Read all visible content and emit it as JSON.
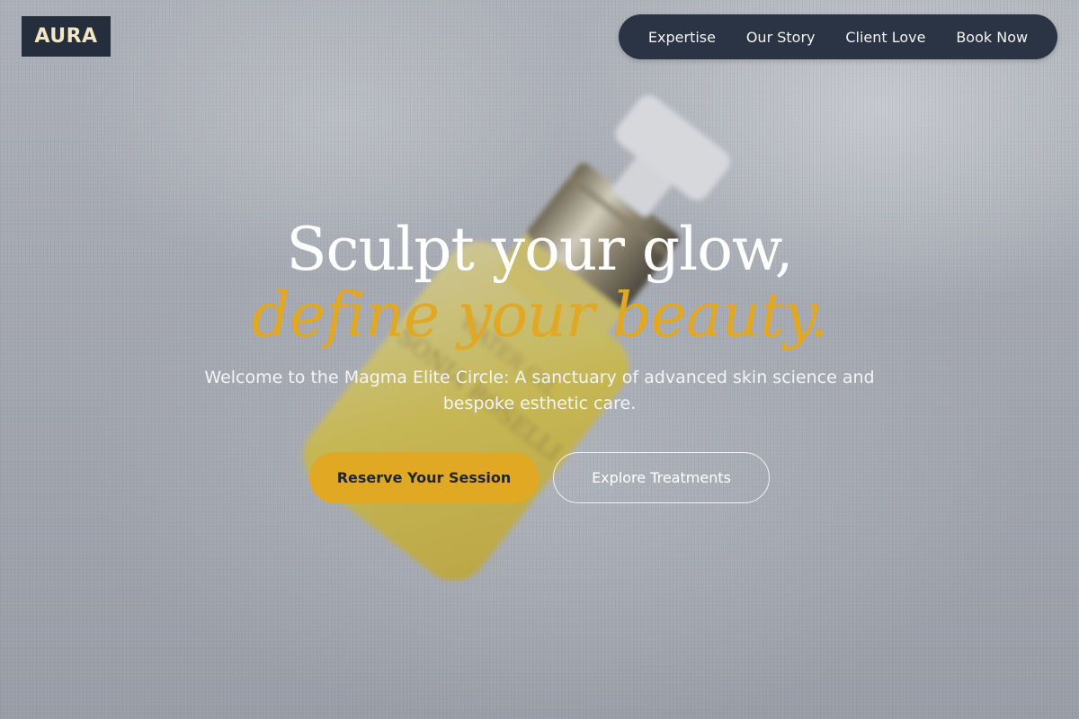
{
  "brand": {
    "logo_text": "AURA"
  },
  "nav": {
    "items": [
      {
        "label": "Expertise"
      },
      {
        "label": "Our Story"
      },
      {
        "label": "Client Love"
      },
      {
        "label": "Book Now"
      }
    ]
  },
  "hero": {
    "headline": "Sculpt your glow,",
    "headline_accent": "define your beauty.",
    "subtitle": "Welcome to the Magma Elite Circle: A sanctuary of advanced skin science and bespoke esthetic care.",
    "primary_button": "Reserve Your Session",
    "secondary_button": "Explore Treatments"
  },
  "colors": {
    "accent": "#e0a823",
    "navy": "#2a3444",
    "logo_text": "#f3e7c3"
  }
}
